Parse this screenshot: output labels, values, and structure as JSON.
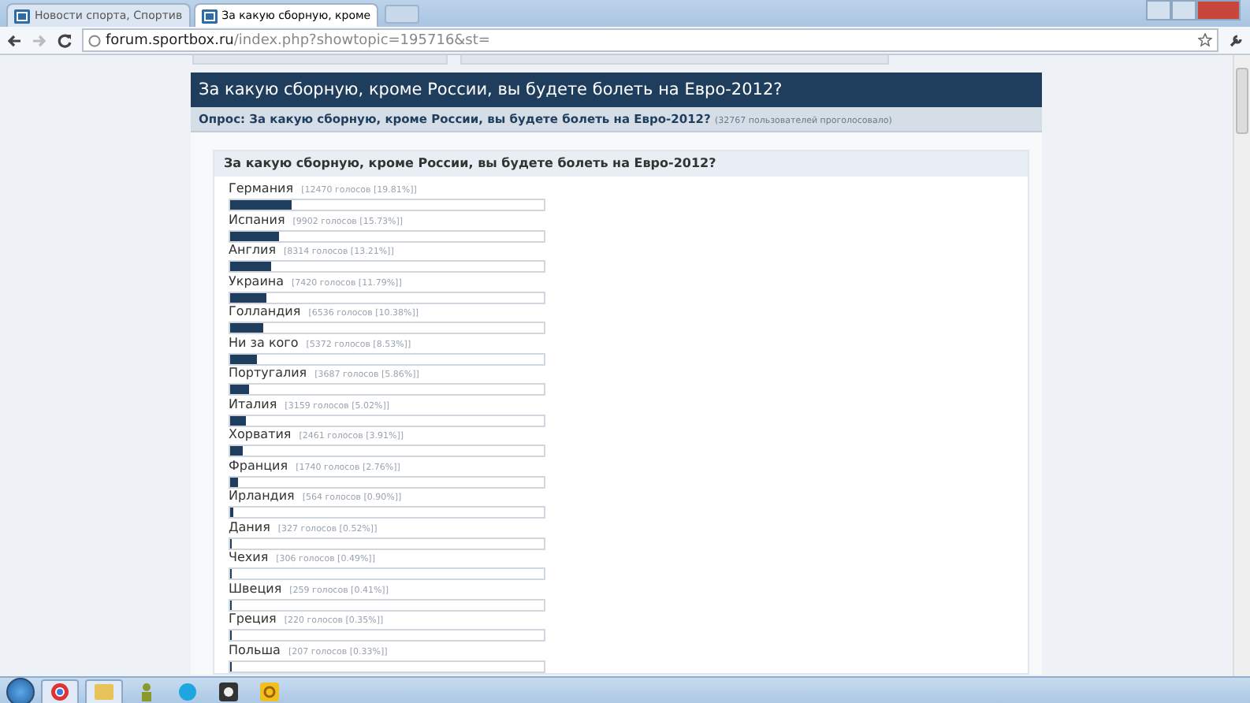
{
  "browser": {
    "tabs": [
      {
        "label": "Новости спорта, Спортив",
        "selected": false
      },
      {
        "label": "За какую сборную, кроме",
        "selected": true
      }
    ],
    "address": {
      "host": "forum.sportbox.ru",
      "path": "/index.php?showtopic=195716&st="
    }
  },
  "topic": {
    "title": "За какую сборную, кроме России, вы будете болеть на Евро-2012?",
    "poll_heading": "Опрос: За какую сборную, кроме России, вы будете болеть на Евро-2012?",
    "poll_votes": "(32767 пользователей проголосовало)",
    "question": "За какую сборную, кроме России, вы будете болеть на Евро-2012?",
    "options": [
      {
        "name": "Германия",
        "votes": "[12470 голосов [19.81%]]",
        "level": 0.1981
      },
      {
        "name": "Испания",
        "votes": "[9902 голосов [15.73%]]",
        "level": 0.1573
      },
      {
        "name": "Англия",
        "votes": "[8314 голосов [13.21%]]",
        "level": 0.1321
      },
      {
        "name": "Украина",
        "votes": "[7420 голосов [11.79%]]",
        "level": 0.1179
      },
      {
        "name": "Голландия",
        "votes": "[6536 голосов [10.38%]]",
        "level": 0.1038
      },
      {
        "name": "Ни за кого",
        "votes": "[5372 голосов [8.53%]]",
        "level": 0.0853
      },
      {
        "name": "Португалия",
        "votes": "[3687 голосов [5.86%]]",
        "level": 0.0586
      },
      {
        "name": "Италия",
        "votes": "[3159 голосов [5.02%]]",
        "level": 0.0502
      },
      {
        "name": "Хорватия",
        "votes": "[2461 голосов [3.91%]]",
        "level": 0.0391
      },
      {
        "name": "Франция",
        "votes": "[1740 голосов [2.76%]]",
        "level": 0.0276
      },
      {
        "name": "Ирландия",
        "votes": "[564 голосов [0.90%]]",
        "level": 0.009
      },
      {
        "name": "Дания",
        "votes": "[327 голосов [0.52%]]",
        "level": 0.0052
      },
      {
        "name": "Чехия",
        "votes": "[306 голосов [0.49%]]",
        "level": 0.0049
      },
      {
        "name": "Швеция",
        "votes": "[259 голосов [0.41%]]",
        "level": 0.0041
      },
      {
        "name": "Греция",
        "votes": "[220 голосов [0.35%]]",
        "level": 0.0035
      },
      {
        "name": "Польша",
        "votes": "[207 голосов [0.33%]]",
        "level": 0.0033
      }
    ]
  }
}
